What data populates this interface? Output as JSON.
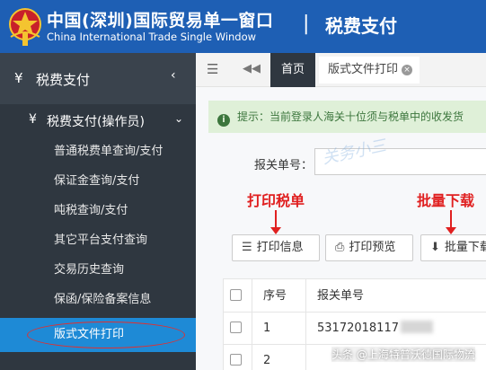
{
  "header": {
    "brand_cn": "中国(深圳)国际贸易单一窗口",
    "brand_en": "China International Trade Single Window",
    "separator": "|",
    "section_title": "税费支付",
    "bg_color": "#1e5fb4"
  },
  "sidebar": {
    "top_item": {
      "icon": "¥",
      "label": "税费支付",
      "chevron": "‹"
    },
    "sub_group": {
      "icon": "¥",
      "label": "税费支付(操作员)",
      "chevron": "⌄"
    },
    "items": [
      {
        "label": "普通税费单查询/支付"
      },
      {
        "label": "保证金查询/支付"
      },
      {
        "label": "吨税查询/支付"
      },
      {
        "label": "其它平台支付查询"
      },
      {
        "label": "交易历史查询"
      },
      {
        "label": "保函/保险备案信息"
      },
      {
        "label": "版式文件打印",
        "active": true
      }
    ],
    "active_color": "#1e8ad6"
  },
  "tabbar": {
    "menu_icon": "☰",
    "back_icon": "◀◀",
    "home_tab": "首页",
    "print_tab": "版式文件打印",
    "close_icon": "×"
  },
  "content": {
    "alert_icon": "i",
    "alert_text": "提示：当前登录人海关十位须与税单中的收发货",
    "form_label": "报关单号：",
    "watermark": "关务小三",
    "annotation_print": "打印税单",
    "annotation_batch": "批量下载",
    "buttons": {
      "print_info": {
        "icon": "☰",
        "label": "打印信息"
      },
      "print_preview": {
        "icon": "⎙",
        "label": "打印预览"
      },
      "batch_download": {
        "icon": "⬇",
        "label": "批量下载"
      }
    },
    "table": {
      "columns": {
        "no": "序号",
        "number": "报关单号"
      },
      "rows": [
        {
          "no": "1",
          "number": "53172018117"
        },
        {
          "no": "2",
          "number": ""
        }
      ]
    },
    "credit": "头条 @上海特普沃德国际物流"
  }
}
